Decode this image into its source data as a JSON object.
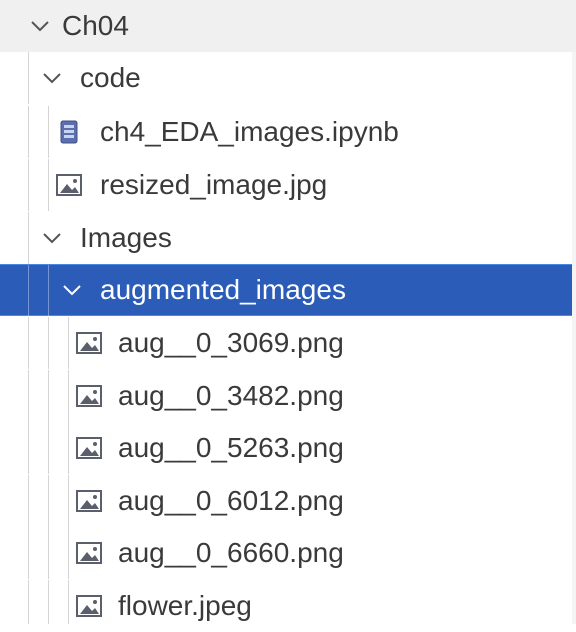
{
  "explorer": {
    "root": {
      "label": "Ch04",
      "expanded": true
    },
    "items": [
      {
        "label": "code",
        "type": "folder",
        "expanded": true
      },
      {
        "label": "ch4_EDA_images.ipynb",
        "type": "notebook",
        "icon": "notebook-icon"
      },
      {
        "label": "resized_image.jpg",
        "type": "image",
        "icon": "image-file-icon"
      },
      {
        "label": "Images",
        "type": "folder",
        "expanded": true
      },
      {
        "label": "augmented_images",
        "type": "folder",
        "expanded": true,
        "selected": true
      },
      {
        "label": "aug__0_3069.png",
        "type": "image",
        "icon": "image-file-icon"
      },
      {
        "label": "aug__0_3482.png",
        "type": "image",
        "icon": "image-file-icon"
      },
      {
        "label": "aug__0_5263.png",
        "type": "image",
        "icon": "image-file-icon"
      },
      {
        "label": "aug__0_6012.png",
        "type": "image",
        "icon": "image-file-icon"
      },
      {
        "label": "aug__0_6660.png",
        "type": "image",
        "icon": "image-file-icon"
      },
      {
        "label": "flower.jpeg",
        "type": "image",
        "icon": "image-file-icon"
      }
    ]
  },
  "colors": {
    "selection": "#2a5cb8",
    "header_bg": "#f0f0f0",
    "text": "#3a3a3a",
    "icon": "#5b5f6b"
  }
}
